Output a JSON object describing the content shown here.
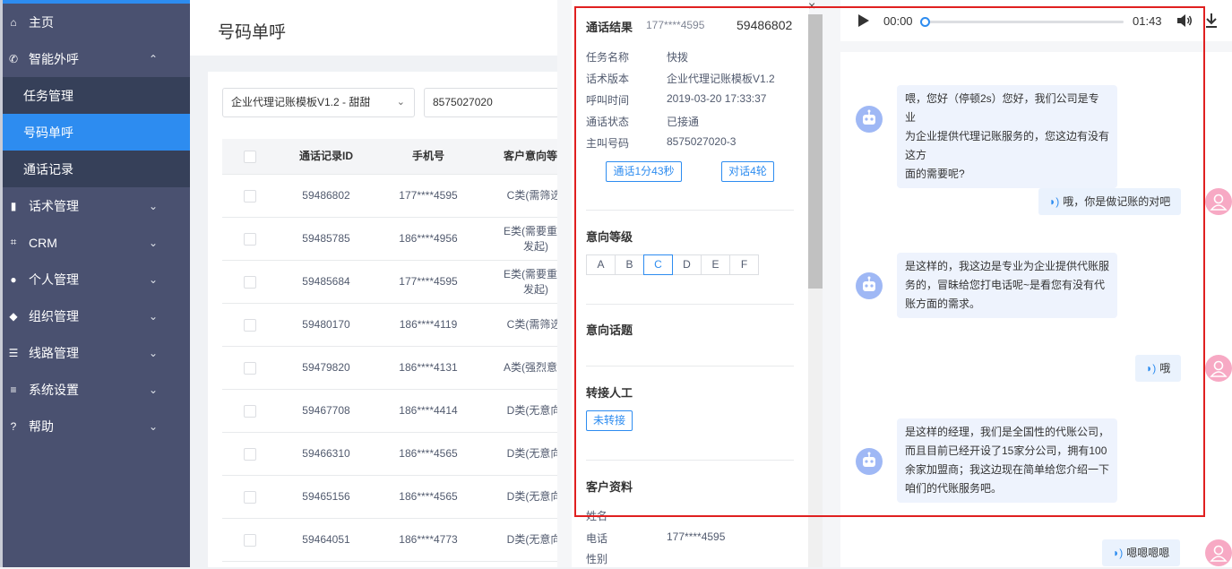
{
  "sidebar": {
    "items": [
      {
        "icon": "home-icon",
        "glyph": "⌂",
        "label": "主页"
      },
      {
        "icon": "phone-icon",
        "glyph": "✆",
        "label": "智能外呼",
        "chevron": "⌃"
      },
      {
        "label": "任务管理"
      },
      {
        "label": "号码单呼"
      },
      {
        "label": "通话记录"
      },
      {
        "icon": "book-icon",
        "glyph": "▮",
        "label": "话术管理",
        "chevron": "⌄"
      },
      {
        "icon": "crop-icon",
        "glyph": "⌗",
        "label": "CRM",
        "chevron": "⌄"
      },
      {
        "icon": "user-icon",
        "glyph": "●",
        "label": "个人管理",
        "chevron": "⌄"
      },
      {
        "icon": "group-icon",
        "glyph": "◆",
        "label": "组织管理",
        "chevron": "⌄"
      },
      {
        "icon": "route-icon",
        "glyph": "☰",
        "label": "线路管理",
        "chevron": "⌄"
      },
      {
        "icon": "settings-sliders-icon",
        "glyph": "≡",
        "label": "系统设置",
        "chevron": "⌄"
      },
      {
        "icon": "help-icon",
        "glyph": "?",
        "label": "帮助",
        "chevron": "⌄"
      }
    ]
  },
  "header": {
    "title": "号码单呼"
  },
  "filters": {
    "template_select": "企业代理记账模板V1.2 - 甜甜",
    "select_arrow": "⌄",
    "number_input": "8575027020"
  },
  "table": {
    "headers": [
      "通话记录ID",
      "手机号",
      "客户意向等级"
    ],
    "rows": [
      {
        "id": "59486802",
        "phone": "177****4595",
        "level": "C类(需筛选)"
      },
      {
        "id": "59485785",
        "phone": "186****4956",
        "level": "E类(需要重新",
        "level2": "发起)"
      },
      {
        "id": "59485684",
        "phone": "177****4595",
        "level": "E类(需要重新",
        "level2": "发起)"
      },
      {
        "id": "59480170",
        "phone": "186****4119",
        "level": "C类(需筛选)"
      },
      {
        "id": "59479820",
        "phone": "186****4131",
        "level": "A类(强烈意向"
      },
      {
        "id": "59467708",
        "phone": "186****4414",
        "level": "D类(无意向)"
      },
      {
        "id": "59466310",
        "phone": "186****4565",
        "level": "D类(无意向)"
      },
      {
        "id": "59465156",
        "phone": "186****4565",
        "level": "D类(无意向)"
      },
      {
        "id": "59464051",
        "phone": "186****4773",
        "level": "D类(无意向)"
      }
    ]
  },
  "detail": {
    "close": "×",
    "result_title": "通话结果",
    "result_phone": "177****4595",
    "result_id": "59486802",
    "fields": [
      {
        "k": "任务名称",
        "v": "快拨"
      },
      {
        "k": "话术版本",
        "v": "企业代理记账模板V1.2"
      },
      {
        "k": "呼叫时间",
        "v": "2019-03-20 17:33:37"
      },
      {
        "k": "通话状态",
        "v": "已接通"
      },
      {
        "k": "主叫号码",
        "v": "8575027020-3"
      }
    ],
    "duration_tag": "通话1分43秒",
    "rounds_tag": "对话4轮",
    "intent_title": "意向等级",
    "levels": [
      "A",
      "B",
      "C",
      "D",
      "E",
      "F"
    ],
    "selected_level": "C",
    "topic_title": "意向话题",
    "transfer_title": "转接人工",
    "transfer_tag": "未转接",
    "customer_title": "客户资料",
    "customer_fields": [
      {
        "k": "姓名",
        "v": ""
      },
      {
        "k": "电话",
        "v": "177****4595"
      },
      {
        "k": "性别",
        "v": ""
      }
    ]
  },
  "player": {
    "current": "00:00",
    "total": "01:43",
    "progress": 0
  },
  "chat": {
    "messages": [
      {
        "from": "bot",
        "lines": [
          "喂，您好（停顿2s）您好，我们公司是专业",
          "为企业提供代理记账服务的，您这边有没有这方",
          "面的需要呢?"
        ]
      },
      {
        "from": "user",
        "text": "哦，你是做记账的对吧"
      },
      {
        "from": "bot",
        "lines": [
          "是这样的，我这边是专业为企业提供代账服",
          "务的，冒昧给您打电话呢~是看您有没有代",
          "账方面的需求。"
        ]
      },
      {
        "from": "user",
        "text": "哦"
      },
      {
        "from": "bot",
        "lines": [
          "是这样的经理，我们是全国性的代账公司，",
          "而且目前已经开设了15家分公司，拥有100",
          "余家加盟商；我这边现在简单给您介绍一下",
          "咱们的代账服务吧。"
        ]
      },
      {
        "from": "user",
        "text": "嗯嗯嗯嗯"
      }
    ]
  },
  "colors": {
    "accent": "#2d8cf0",
    "sidebar": "#4a5170",
    "highlight_box": "#e02020"
  }
}
